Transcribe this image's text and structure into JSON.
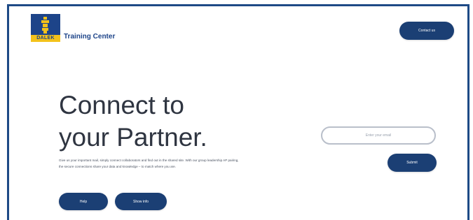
{
  "header": {
    "logo_text": "DALEK",
    "brand_name": "Training Center",
    "contact_label": "Contact us"
  },
  "hero": {
    "headline_line1": "Connect to",
    "headline_line2": "your Partner.",
    "lead": "Give us your important mail, simply connect collaborators and find out in the shared site. With our group leadership AP pairing, the secure connections share your data and knowledge – to match where you are.",
    "help_label": "Help",
    "show_label": "Show info"
  },
  "form": {
    "email_placeholder": "Enter your email",
    "submit_label": "Submit"
  },
  "colors": {
    "primary": "#1b3f74",
    "logo_blue": "#1d4489",
    "logo_yellow": "#f3c21b",
    "frame_border": "#1e4a86",
    "text_dark": "#2f3541"
  }
}
